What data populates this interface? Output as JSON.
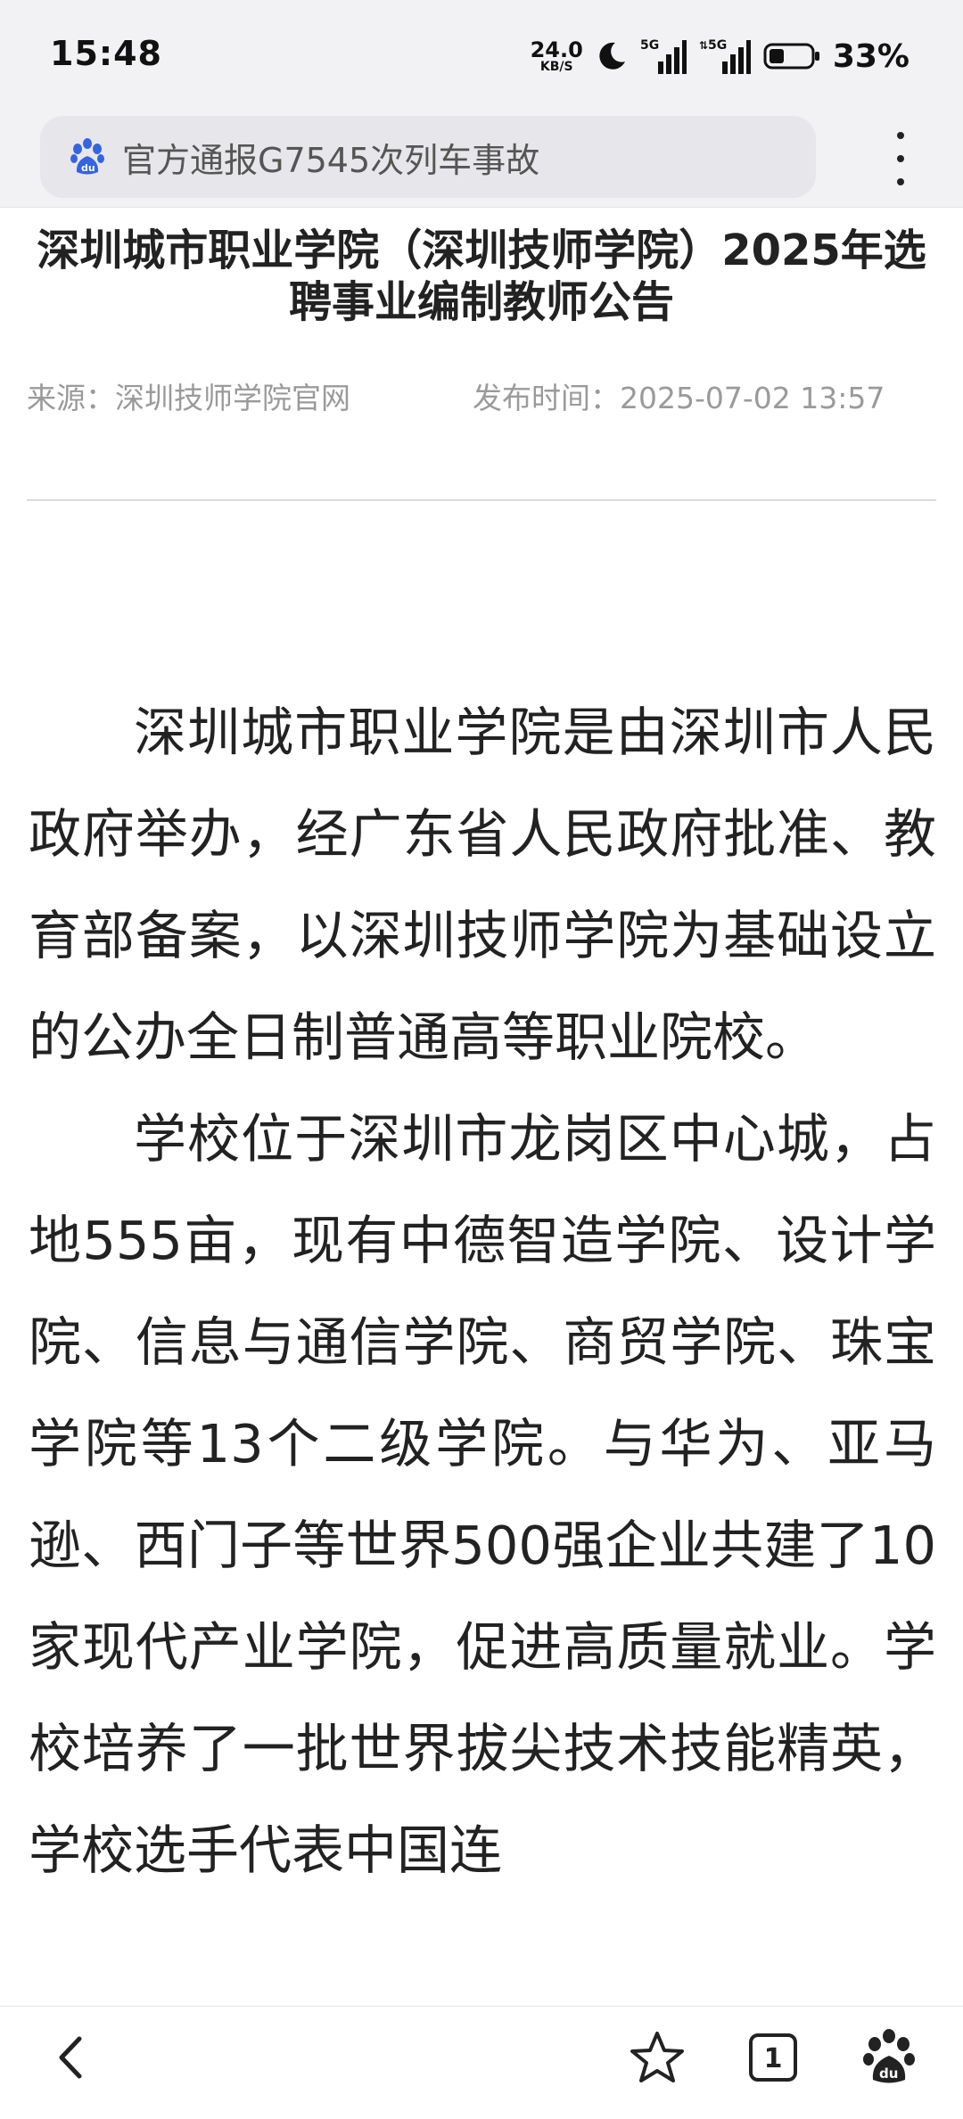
{
  "status_bar": {
    "time": "15:48",
    "net_speed_value": "24.0",
    "net_speed_unit": "KB/S",
    "signal_1": "5G",
    "signal_2": "5G",
    "battery": "33%"
  },
  "search": {
    "query": "官方通报G7545次列车事故"
  },
  "article": {
    "title": "深圳城市职业学院（深圳技师学院）2025年选聘事业编制教师公告",
    "source": "来源：深圳技师学院官网",
    "published": "发布时间：2025-07-02 13:57",
    "paragraphs": [
      "深圳城市职业学院是由深圳市人民政府举办，经广东省人民政府批准、教育部备案，以深圳技师学院为基础设立的公办全日制普通高等职业院校。",
      "学校位于深圳市龙岗区中心城，占地555亩，现有中德智造学院、设计学院、信息与通信学院、商贸学院、珠宝学院等13个二级学院。与华为、亚马逊、西门子等世界500强企业共建了10家现代产业学院，促进高质量就业。学校培养了一批世界拔尖技术技能精英，学校选手代表中国连"
    ]
  },
  "bottom_nav": {
    "tab_count": "1"
  },
  "icons": {
    "baidu": "baidu-paw-icon",
    "more": "more-vertical-icon",
    "back": "back-chevron-icon",
    "favorite": "star-icon",
    "tabs": "tabs-icon",
    "home": "baidu-home-icon",
    "moon": "moon-icon",
    "signal": "signal-icon",
    "battery": "battery-icon"
  },
  "colors": {
    "baidu_blue": "#3464e0",
    "meta_gray": "#9a9a9a",
    "text": "#222222"
  }
}
